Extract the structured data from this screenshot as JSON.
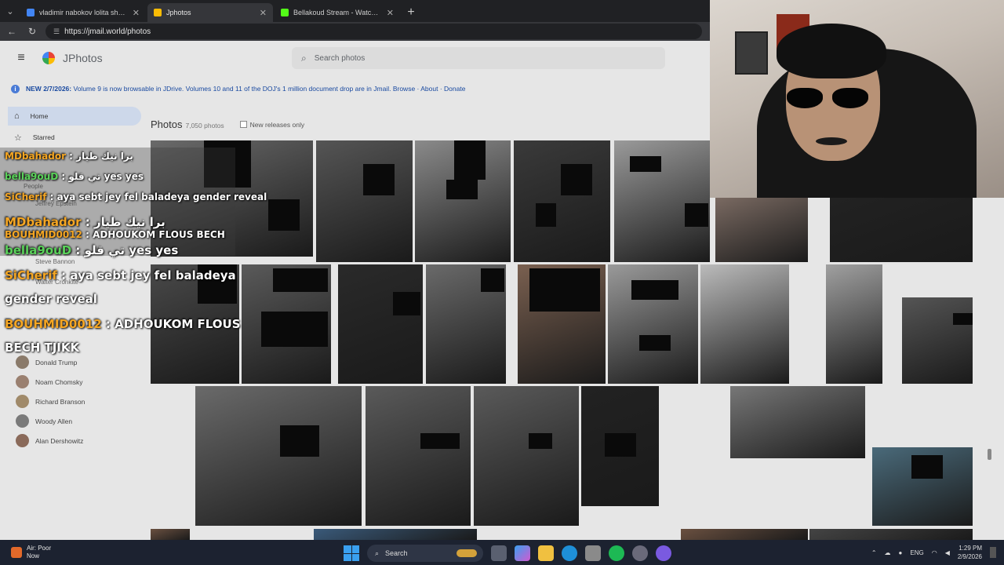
{
  "browser": {
    "tabs": [
      {
        "title": "vladimir nabokov lolita she was lo",
        "favicon_color": "#4285f4",
        "active": false
      },
      {
        "title": "Jphotos",
        "favicon_color": "#fbbc05",
        "active": true
      },
      {
        "title": "Bellakoud Stream - Watch Live on",
        "favicon_color": "#53fc18",
        "active": false
      }
    ],
    "url": "https://jmail.world/photos"
  },
  "app": {
    "name": "JPhotos",
    "search_placeholder": "Search photos",
    "notice": {
      "prefix": "NEW 2/7/2026:",
      "text": "Volume 9 is now browsable in JDrive. Volumes 10 and 11 of the DOJ's 1 million document drop are in Jmail.",
      "links": [
        "Browse",
        "About",
        "Donate"
      ]
    },
    "sidebar": {
      "items": [
        {
          "label": "Home",
          "icon": "home-icon",
          "active": true
        },
        {
          "label": "Starred",
          "icon": "star-icon",
          "active": false
        }
      ],
      "people_partial": [
        "People",
        "Jeffrey Epstein",
        "Steve Bannon",
        "Walter Cronkite"
      ],
      "people": [
        "Donald Trump",
        "Noam Chomsky",
        "Richard Branson",
        "Woody Allen",
        "Alan Dershowitz"
      ]
    },
    "photos_header": {
      "title": "Photos",
      "count": "7,050 photos",
      "filter_label": "New releases only"
    }
  },
  "chat": [
    {
      "user": "MDbahador",
      "sep": ":",
      "msg": "برا نيك طيار",
      "color": "#f5a623",
      "size": "small"
    },
    {
      "user": "bella9ouD",
      "sep": ":",
      "msg": "تي قلو yes yes",
      "color": "#5ad25a",
      "size": "small"
    },
    {
      "user": "SiCherif",
      "sep": ":",
      "msg": "aya sebt jey fel baladeya gender reveal",
      "color": "#f5a623",
      "size": "small"
    },
    {
      "user": "MDbahador",
      "sep": ":",
      "msg": "برا نيك طيار",
      "color": "#f5a623",
      "size": "large"
    },
    {
      "user": "BOUHMID0012",
      "sep": ":",
      "msg": "ADHOUKOM FLOUS BECH",
      "color": "#f5a623",
      "size": "small"
    },
    {
      "user": "bella9ouD",
      "sep": ":",
      "msg": "تي قلو yes yes",
      "color": "#5ad25a",
      "size": "large"
    },
    {
      "user": "SiCherif",
      "sep": ":",
      "msg": "aya sebt jey fel baladeya",
      "color": "#f5a623",
      "size": "large"
    },
    {
      "user": "",
      "sep": "",
      "msg": "gender reveal",
      "color": "#ffffff",
      "size": "large"
    },
    {
      "user": "BOUHMID0012",
      "sep": ":",
      "msg": "ADHOUKOM FLOUS",
      "color": "#f5a623",
      "size": "large"
    },
    {
      "user": "",
      "sep": "",
      "msg": "BECH TJIKK",
      "color": "#ffffff",
      "size": "large"
    }
  ],
  "taskbar": {
    "weather_title": "Air: Poor",
    "weather_sub": "Now",
    "search_label": "Search",
    "lang": "ENG",
    "time": "1:29 PM",
    "date": "2/9/2026"
  }
}
